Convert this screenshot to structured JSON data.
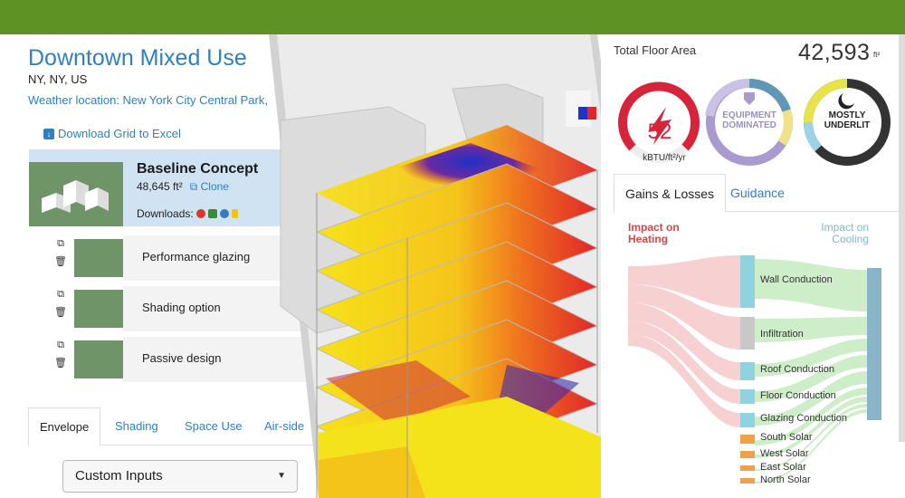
{
  "colors": {
    "topbar": "#5e9225",
    "link": "#2f80c0",
    "heat": "#d64545",
    "cool": "#7fb9c9",
    "gauge_red": "#d6243a",
    "eq_purple": "#a99bd0",
    "ul_yellow": "#e9e34a"
  },
  "project": {
    "title": "Downtown Mixed Use",
    "location": "NY, NY, US",
    "weather": "Weather location: New York City Central Park,",
    "download_grid": "Download Grid to Excel"
  },
  "baseline": {
    "title": "Baseline Concept",
    "area": "48,645 ft²",
    "clone": "Clone",
    "downloads": "Downloads:"
  },
  "variants": [
    {
      "label": "Performance glazing"
    },
    {
      "label": "Shading option"
    },
    {
      "label": "Passive design"
    }
  ],
  "tabs": [
    "Envelope",
    "Shading",
    "Space Use",
    "Air-side"
  ],
  "select": {
    "value": "Custom Inputs"
  },
  "metrics": {
    "tfa_label": "Total Floor Area",
    "tfa_value": "42,593",
    "tfa_unit": "ft²",
    "eui_value": "52",
    "eui_unit": "kBTU/ft²/yr",
    "eq_line1": "EQUIPMENT",
    "eq_line2": "DOMINATED",
    "ul_line1": "MOSTLY",
    "ul_line2": "UNDERLIT"
  },
  "right_tabs": [
    "Gains & Losses",
    "Guidance"
  ],
  "impact": {
    "heating_1": "Impact on",
    "heating_2": "Heating",
    "cooling_1": "Impact on",
    "cooling_2": "Cooling"
  },
  "sankey": [
    {
      "label": "Wall Conduction"
    },
    {
      "label": "Infiltration"
    },
    {
      "label": "Roof Conduction"
    },
    {
      "label": "Floor Conduction"
    },
    {
      "label": "Glazing Conduction"
    },
    {
      "label": "South Solar"
    },
    {
      "label": "West Solar"
    },
    {
      "label": "East Solar"
    },
    {
      "label": "North Solar"
    }
  ]
}
